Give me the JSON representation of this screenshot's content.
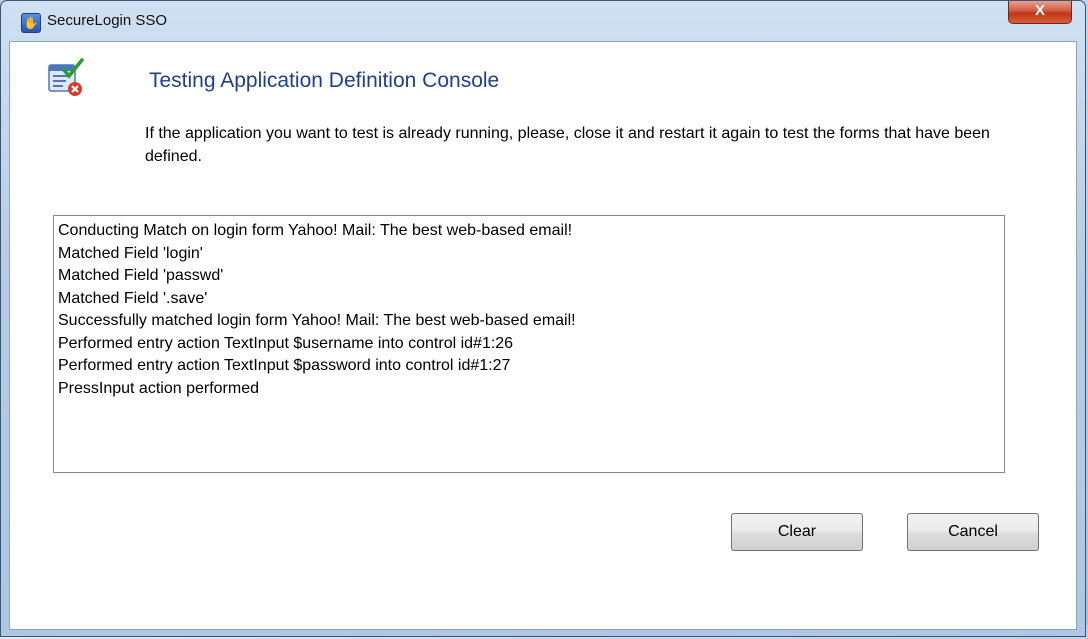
{
  "window": {
    "title": "SecureLogin SSO",
    "close_glyph": "X"
  },
  "header": {
    "icon": "application-definition-check-icon",
    "heading": "Testing Application Definition Console",
    "description": "If the application you want to test is already running, please, close it and restart it again to test the forms that have been defined."
  },
  "log": {
    "lines": [
      "Conducting Match on login form Yahoo! Mail: The best web-based email!",
      "Matched Field 'login'",
      "Matched Field 'passwd'",
      "Matched Field '.save'",
      "Successfully matched login form Yahoo! Mail: The best web-based email!",
      "Performed entry action TextInput $username into control id#1:26",
      "Performed entry action TextInput $password into control id#1:27",
      "PressInput action performed"
    ]
  },
  "buttons": {
    "clear": "Clear",
    "cancel": "Cancel"
  },
  "colors": {
    "heading": "#1e3f8f",
    "close_button": "#c03418"
  }
}
